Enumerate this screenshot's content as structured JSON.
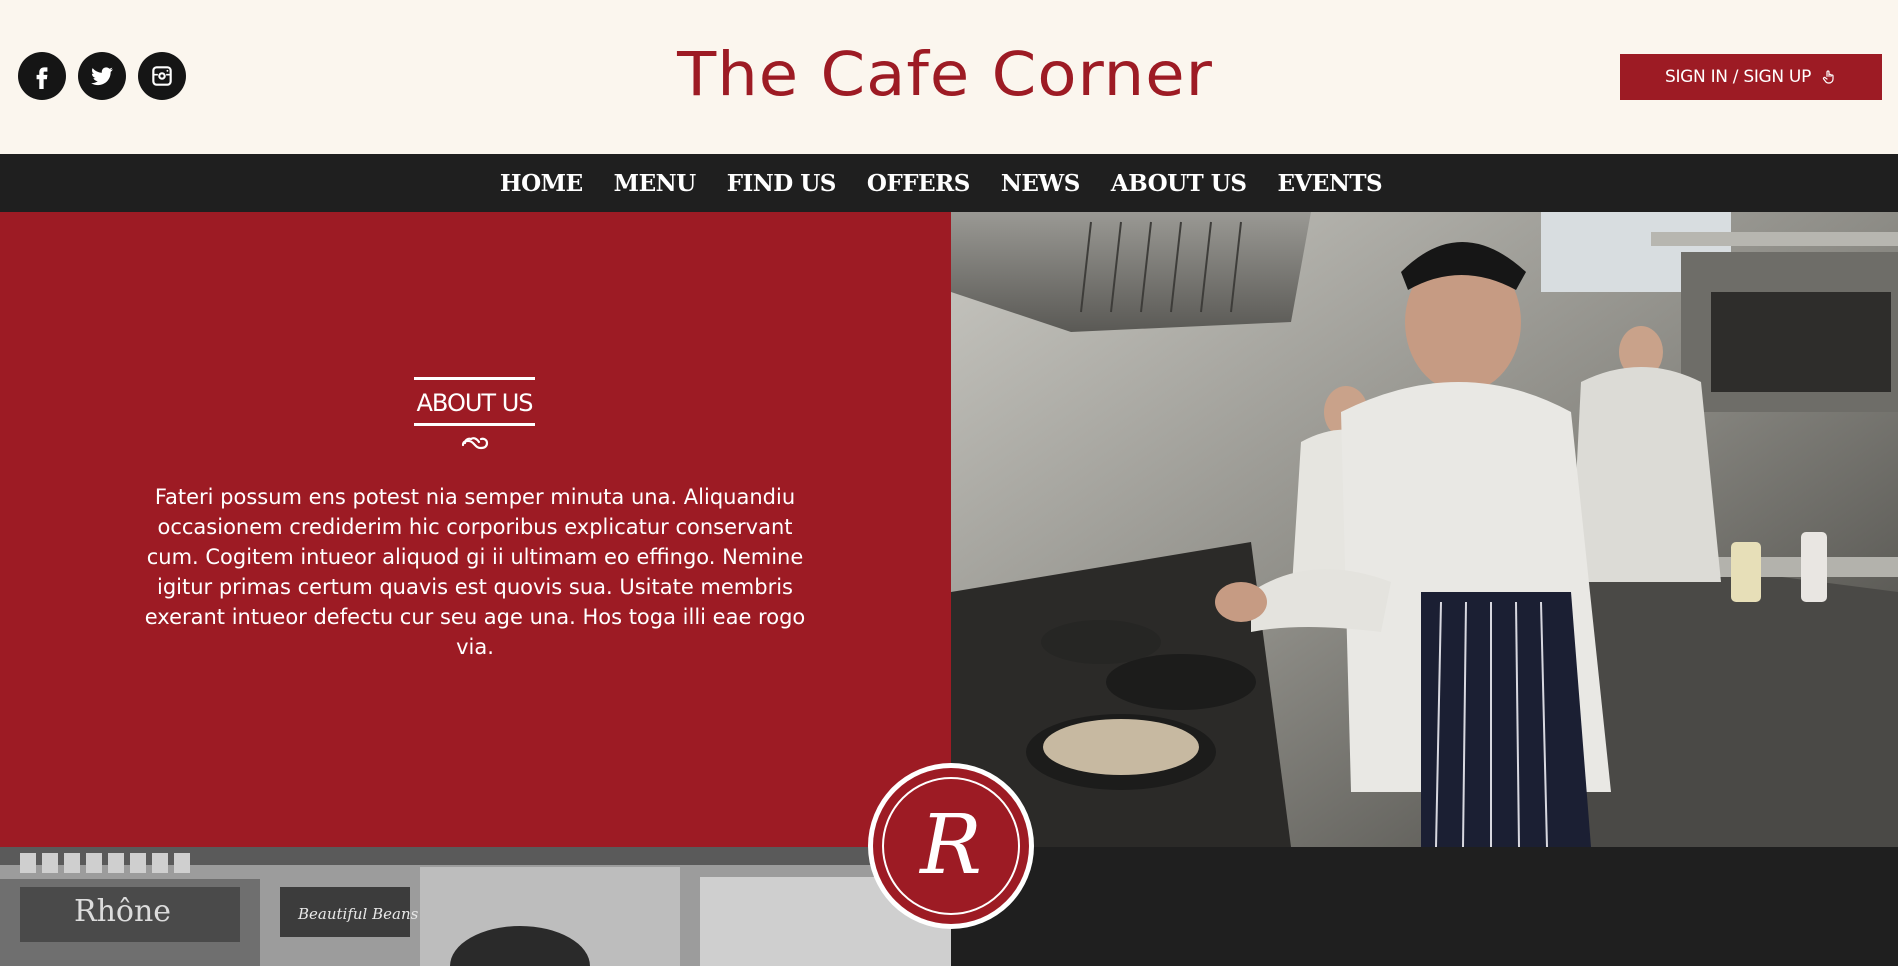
{
  "header": {
    "site_title": "The Cafe Corner",
    "signin_label": "SIGN IN / SIGN UP",
    "social": [
      {
        "icon": "facebook-icon"
      },
      {
        "icon": "twitter-icon"
      },
      {
        "icon": "instagram-icon"
      }
    ]
  },
  "nav": {
    "items": [
      "HOME",
      "MENU",
      "FIND US",
      "OFFERS",
      "NEWS",
      "ABOUT US",
      "EVENTS"
    ]
  },
  "about": {
    "heading": "ABOUT US",
    "body": "Fateri possum ens potest nia semper minuta una. Aliquandiu occasionem crediderim hic corporibus explicatur conservant cum. Cogitem intueor aliquod gi ii ultimam eo effingo. Nemine igitur primas certum quavis est quovis sua. Usitate membris exerant intueor defectu cur seu age una. Hos toga illi eae rogo via."
  },
  "badge": {
    "monogram": "R"
  },
  "photos": {
    "shop_sign_1": "Rhône",
    "shop_sign_2": "Beautiful Beans"
  },
  "colors": {
    "brand_red": "#9d1b24",
    "cream": "#fbf6ee",
    "dark": "#1f1f1f"
  }
}
